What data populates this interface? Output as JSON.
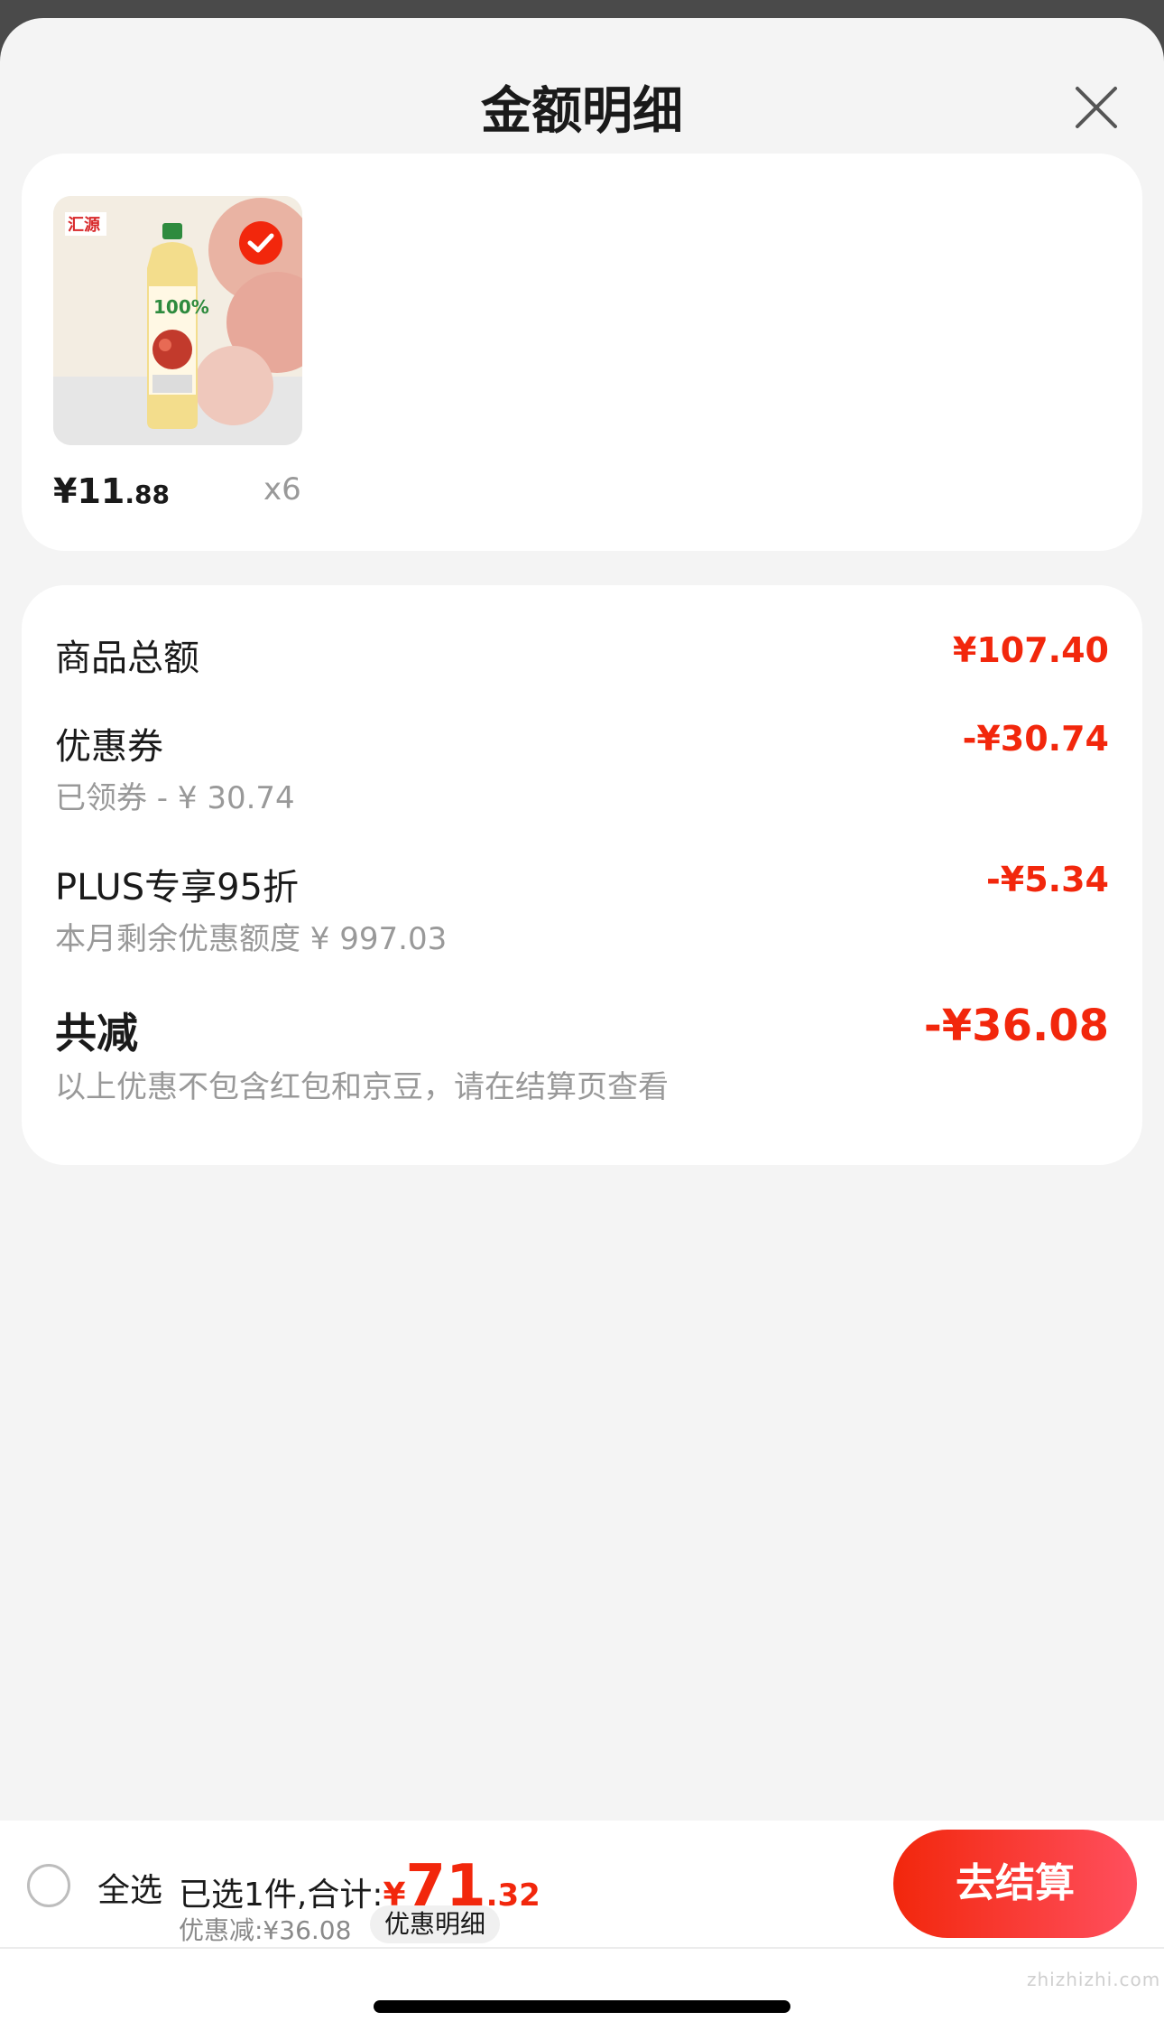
{
  "header": {
    "title": "金额明细",
    "close_icon": "close-icon"
  },
  "product": {
    "image_icon": "apple-juice-bottle-image",
    "selected": true,
    "price_currency": "¥",
    "price_int": "11",
    "price_dec": ".88",
    "quantity": "x6"
  },
  "summary": {
    "goods_total_label": "商品总额",
    "goods_total_amount": "¥107.40",
    "coupon_label": "优惠券",
    "coupon_sub": "已领券 - ¥ 30.74",
    "coupon_amount": "-¥30.74",
    "plus_label": "PLUS专享95折",
    "plus_sub": "本月剩余优惠额度 ¥ 997.03",
    "plus_amount": "-¥5.34",
    "total_label": "共减",
    "total_amount": "-¥36.08",
    "note": "以上优惠不包含红包和京豆，请在结算页查看"
  },
  "bottom_bar": {
    "select_all": "全选",
    "selected_text": "已选1件,合计:",
    "total_currency": "¥",
    "total_int": "71",
    "total_dec": ".32",
    "discount_text": "优惠减:¥36.08",
    "detail_chip": "优惠明细",
    "checkout_label": "去结算"
  },
  "watermark": "zhizhizhi.com",
  "colors": {
    "accent": "#f2270c",
    "sheet_bg": "#f4f4f4",
    "card_bg": "#ffffff"
  }
}
